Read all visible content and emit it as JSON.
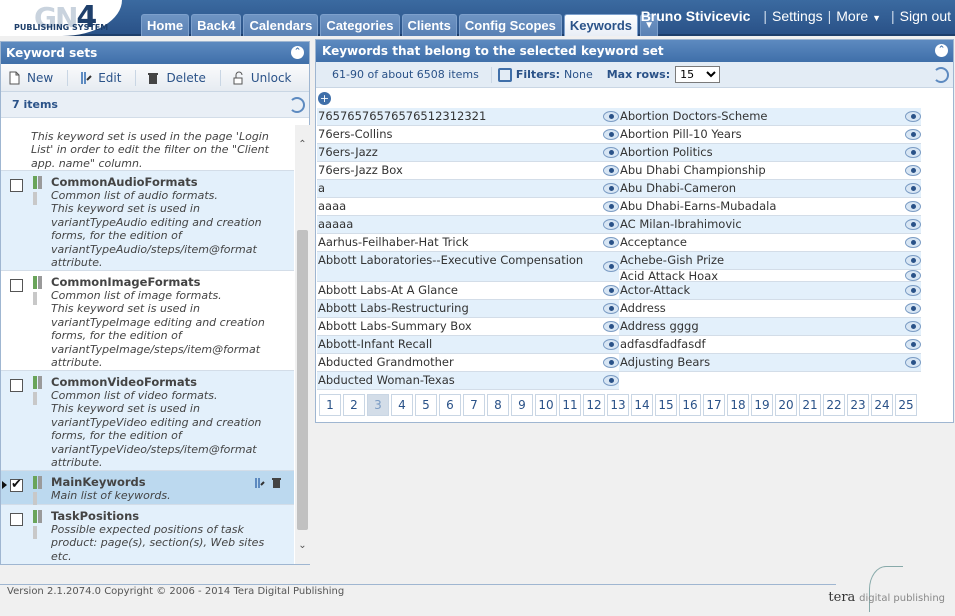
{
  "logo": {
    "brand": "GN",
    "version_mark": "4",
    "subtitle": "PUBLISHING SYSTEM"
  },
  "nav": {
    "tabs": [
      "Home",
      "Back4",
      "Calendars",
      "Categories",
      "Clients",
      "Config Scopes",
      "Keywords"
    ],
    "active": "Keywords",
    "more_tab_glyph": "▼"
  },
  "user": {
    "name": "Bruno Stivicevic",
    "settings": "Settings",
    "more": "More",
    "signout": "Sign out"
  },
  "keyword_sets": {
    "title": "Keyword sets",
    "toolbar": {
      "new": "New",
      "edit": "Edit",
      "delete": "Delete",
      "unlock": "Unlock"
    },
    "count_label": "7 items",
    "first_desc": "This keyword set is used in the page 'Login List' in order to edit the filter on the \"Client app. name\" column.",
    "items": [
      {
        "name": "CommonAudioFormats",
        "desc": "Common list of audio formats.\nThis keyword set is used in variantTypeAudio editing and creation forms, for the edition of variantTypeAudio/steps/item@format attribute."
      },
      {
        "name": "CommonImageFormats",
        "desc": "Common list of image formats.\nThis keyword set is used in variantTypeImage editing and creation forms, for the edition of variantTypeImage/steps/item@format attribute."
      },
      {
        "name": "CommonVideoFormats",
        "desc": "Common list of video formats.\nThis keyword set is used in variantTypeVideo editing and creation forms, for the edition of variantTypeVideo/steps/item@format attribute."
      },
      {
        "name": "MainKeywords",
        "desc": "Main list of keywords.",
        "checked": true
      },
      {
        "name": "TaskPositions",
        "desc": "Possible expected positions of task product: page(s), section(s), Web sites etc."
      }
    ]
  },
  "keywords": {
    "title": "Keywords that belong to the selected keyword set",
    "range": "61-90 of about 6508 items",
    "filters_label": "Filters:",
    "filters_value": "None",
    "maxrows_label": "Max rows:",
    "maxrows_value": "15",
    "left_col": [
      "7657657657657651231232​1",
      "76ers-Collins",
      "76ers-Jazz",
      "76ers-Jazz Box",
      "a",
      "aaaa",
      "aaaaa",
      "Aarhus-Feilhaber-Hat Trick",
      "Abbott Laboratories--Executive Compensation",
      "Abbott Labs-At A Glance",
      "Abbott Labs-Restructuring",
      "Abbott Labs-Summary Box",
      "Abbott-Infant Recall",
      "Abducted Grandmother",
      "Abducted Woman-Texas"
    ],
    "right_col": [
      "Abortion Doctors-Scheme",
      "Abortion Pill-10 Years",
      "Abortion Politics",
      "Abu Dhabi Championship",
      "Abu Dhabi-Cameron",
      "Abu Dhabi-Earns-Mubadala",
      "AC Milan-Ibrahimovic",
      "Acceptance",
      "Achebe-Gish Prize",
      "Acid Attack Hoax",
      "Actor-Attack",
      "Address",
      "Address gggg",
      "adfasdfadfasdf",
      "Adjusting Bears"
    ],
    "pages": [
      "1",
      "2",
      "3",
      "4",
      "5",
      "6",
      "7",
      "8",
      "9",
      "10",
      "11",
      "12",
      "13",
      "14",
      "15",
      "16",
      "17",
      "18",
      "19",
      "20",
      "21",
      "22",
      "23",
      "24",
      "25"
    ],
    "current_page": "3"
  },
  "footer": {
    "version": "Version 2.1.2074.0 Copyright © 2006 - 2014 Tera Digital Publishing",
    "brand": "tera",
    "brand_sub": "digital publishing"
  },
  "colors": {
    "header": "#3f6fa9",
    "accent": "#2a5288",
    "row_alt": "#e3f0fb",
    "row_selected": "#bcd9ef"
  }
}
